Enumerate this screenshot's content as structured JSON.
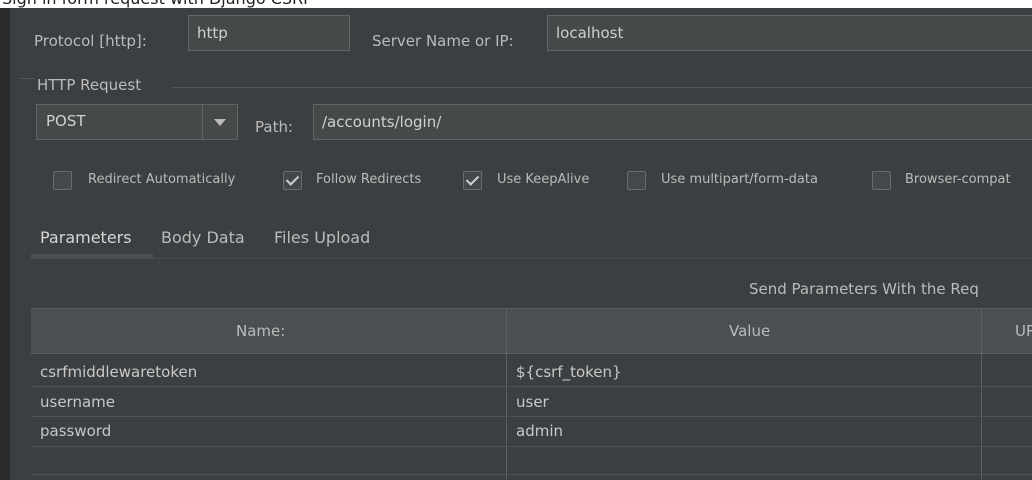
{
  "top_strip": {
    "text": "Sign in form request with Django CSRF"
  },
  "server": {
    "protocol_label": "Protocol [http]:",
    "protocol_value": "http",
    "server_label": "Server Name or IP:",
    "server_value": "localhost"
  },
  "http_request": {
    "group_title": "HTTP Request",
    "method": "POST",
    "path_label": "Path:",
    "path_value": "/accounts/login/"
  },
  "options": [
    {
      "label": "Redirect Automatically",
      "checked": false
    },
    {
      "label": "Follow Redirects",
      "checked": true
    },
    {
      "label": "Use KeepAlive",
      "checked": true
    },
    {
      "label": "Use multipart/form-data",
      "checked": false
    },
    {
      "label": "Browser-compat",
      "checked": false
    }
  ],
  "tabs": [
    {
      "label": "Parameters",
      "active": true
    },
    {
      "label": "Body Data",
      "active": false
    },
    {
      "label": "Files Upload",
      "active": false
    }
  ],
  "send_params_label": "Send Parameters With the Req",
  "table": {
    "columns": [
      "Name:",
      "Value",
      "URL"
    ],
    "rows": [
      {
        "name": "csrfmiddlewaretoken",
        "value": "${csrf_token}"
      },
      {
        "name": "username",
        "value": "user"
      },
      {
        "name": "password",
        "value": "admin"
      }
    ]
  },
  "colors": {
    "panel_bg": "#3c3f41",
    "field_bg": "#45494a",
    "header_bg": "#4b4f52",
    "text": "#bbbbbb"
  }
}
